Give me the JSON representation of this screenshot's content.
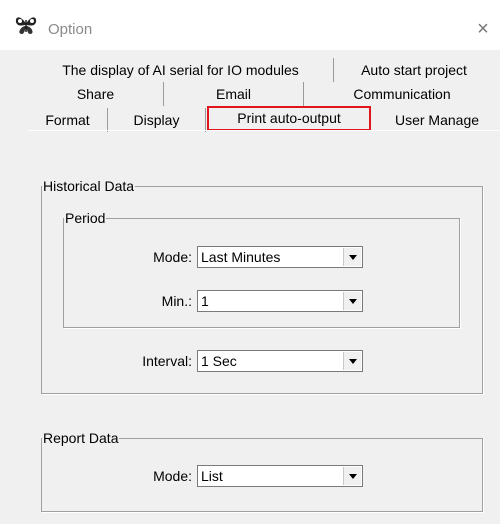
{
  "window": {
    "title": "Option",
    "close_glyph": "×"
  },
  "tabs": {
    "row1": [
      {
        "label": "The display of AI serial for IO modules"
      },
      {
        "label": "Auto start project"
      }
    ],
    "row2": [
      {
        "label": "Share"
      },
      {
        "label": "Email"
      },
      {
        "label": "Communication"
      }
    ],
    "row3": [
      {
        "label": "Format"
      },
      {
        "label": "Display"
      },
      {
        "label": "Print auto-output",
        "selected": true,
        "highlight_color": "#e0141c"
      },
      {
        "label": "User Manage"
      }
    ]
  },
  "historical": {
    "title": "Historical Data",
    "period": {
      "title": "Period",
      "mode_label": "Mode:",
      "mode_value": "Last Minutes",
      "min_label": "Min.:",
      "min_value": "1"
    },
    "interval_label": "Interval:",
    "interval_value": "1 Sec"
  },
  "report": {
    "title": "Report Data",
    "mode_label": "Mode:",
    "mode_value": "List"
  },
  "icons": {
    "app": "butterfly-icon",
    "close": "close-icon",
    "dropdown": "chevron-down-icon"
  }
}
